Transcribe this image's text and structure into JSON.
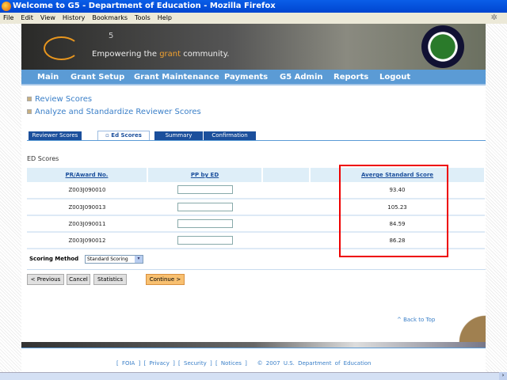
{
  "window": {
    "title": "Welcome to G5 - Department of Education - Mozilla Firefox"
  },
  "menu": [
    "File",
    "Edit",
    "View",
    "History",
    "Bookmarks",
    "Tools",
    "Help"
  ],
  "banner": {
    "logo": "G5",
    "tagline_pre": "Empowering the ",
    "tagline_accent": "grant",
    "tagline_post": " community."
  },
  "nav": [
    "Main",
    "Grant Setup",
    "Grant Maintenance",
    "Payments",
    "G5 Admin",
    "Reports",
    "Logout"
  ],
  "links": [
    "Review Scores",
    "Analyze and Standardize Reviewer Scores"
  ],
  "tabs": [
    "Reviewer Scores",
    "Ed Scores",
    "Summary",
    "Confirmation"
  ],
  "active_tab": "Ed Scores",
  "section_title": "ED Scores",
  "table": {
    "headers": [
      "PR/Award No.",
      "PP by ED",
      "",
      "Averge Standard Score"
    ],
    "rows": [
      {
        "award": "Z003J090010",
        "pp": "",
        "score": "93.40"
      },
      {
        "award": "Z003J090013",
        "pp": "",
        "score": "105.23"
      },
      {
        "award": "Z003J090011",
        "pp": "",
        "score": "84.59"
      },
      {
        "award": "Z003J090012",
        "pp": "",
        "score": "86.28"
      }
    ]
  },
  "scoring": {
    "label": "Scoring Method",
    "value": "Standard Scoring"
  },
  "buttons": {
    "previous": "< Previous",
    "cancel": "Cancel",
    "statistics": "Statistics",
    "continue": "Continue >"
  },
  "back_to_top": "^ Back to Top",
  "footer": {
    "foia": "[ FOIA ]",
    "privacy": "[ Privacy ]",
    "security": "[ Security ]",
    "notices": "[ Notices ]",
    "copyright": "© 2007 U.S. Department of Education"
  },
  "colors": {
    "nav": "#5b9bd5",
    "tab": "#1b4f9c",
    "highlight": "#e00000",
    "continue": "#f8c070"
  }
}
